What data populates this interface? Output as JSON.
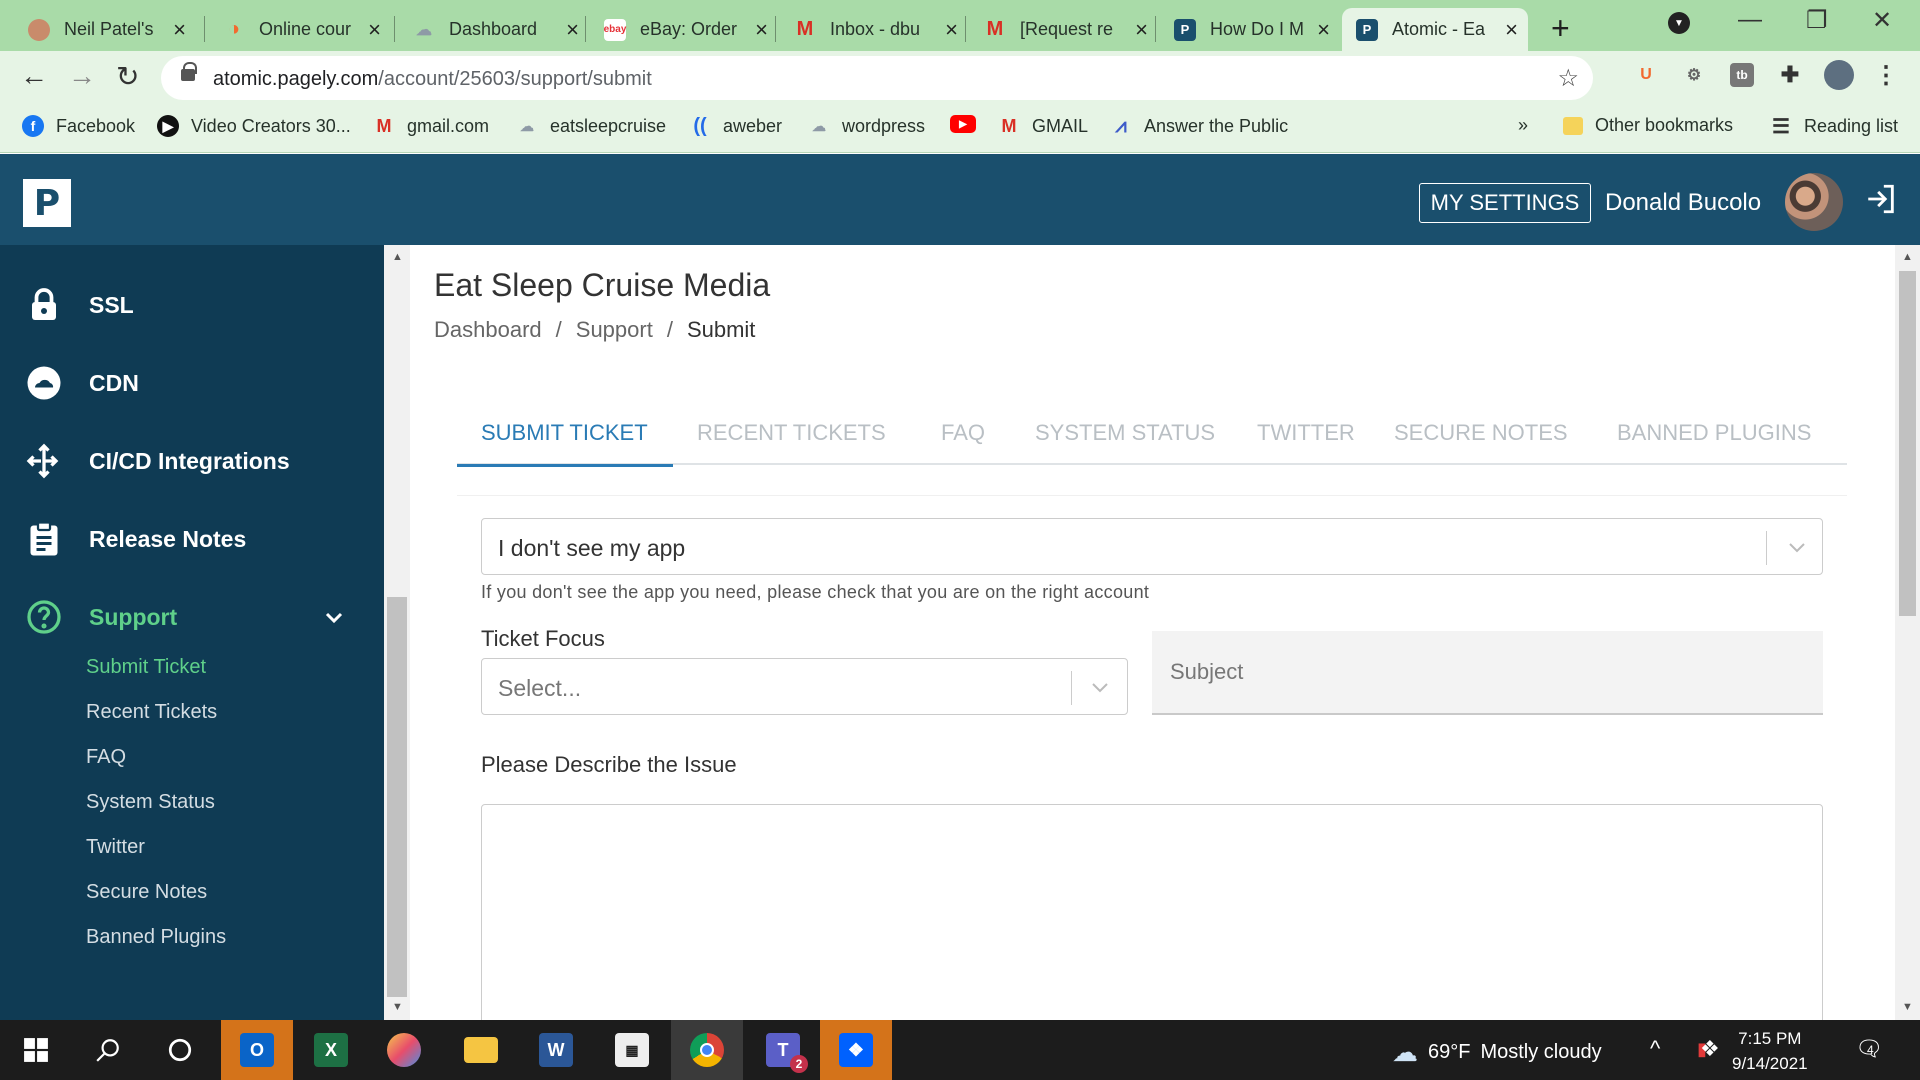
{
  "browser": {
    "tabs": [
      {
        "title": "Neil Patel's",
        "favicon_color": "#c98b6b"
      },
      {
        "title": "Online cour",
        "favicon_color": "#f26a2f"
      },
      {
        "title": "Dashboard",
        "favicon_color": "#8e9aa6"
      },
      {
        "title": "eBay: Order",
        "favicon_color": "#e53238"
      },
      {
        "title": "Inbox - dbu",
        "favicon_color": "#d93025"
      },
      {
        "title": "[Request re",
        "favicon_color": "#d93025"
      },
      {
        "title": "How Do I M",
        "favicon_color": "#1a4f6d"
      },
      {
        "title": "Atomic - Ea",
        "favicon_color": "#1a4f6d"
      }
    ],
    "active_tab": 7,
    "url_host": "atomic.pagely.com",
    "url_path": "/account/25603/support/submit",
    "bookmarks": [
      {
        "label": "Facebook",
        "icon": "facebook-icon",
        "color": "#1877f2"
      },
      {
        "label": "Video Creators 30...",
        "icon": "video-icon",
        "color": "#111111"
      },
      {
        "label": "gmail.com",
        "icon": "gmail-icon",
        "color": "#d93025"
      },
      {
        "label": "eatsleepcruise",
        "icon": "cloud-icon",
        "color": "#8e9aa6"
      },
      {
        "label": "aweber",
        "icon": "aweber-icon",
        "color": "#246be8"
      },
      {
        "label": "wordpress",
        "icon": "cloud-icon",
        "color": "#8e9aa6"
      },
      {
        "label": "GMAIL",
        "icon": "gmail-icon",
        "color": "#d93025"
      },
      {
        "label": "Answer the Public",
        "icon": "atp-icon",
        "color": "#3d5bc9"
      }
    ],
    "other_bookmarks": "Other bookmarks",
    "reading_list": "Reading list",
    "overflow": "»"
  },
  "header": {
    "logo_letter": "P",
    "my_settings": "MY SETTINGS",
    "user_name": "Donald Bucolo"
  },
  "sidebar": {
    "items": [
      {
        "label": "SSL",
        "icon": "lock-icon"
      },
      {
        "label": "CDN",
        "icon": "cloud-icon"
      },
      {
        "label": "CI/CD Integrations",
        "icon": "arrows-icon"
      },
      {
        "label": "Release Notes",
        "icon": "clipboard-icon"
      },
      {
        "label": "Support",
        "icon": "help-circle-icon"
      }
    ],
    "support_subitems": [
      "Submit Ticket",
      "Recent Tickets",
      "FAQ",
      "System Status",
      "Twitter",
      "Secure Notes",
      "Banned Plugins"
    ]
  },
  "main": {
    "org_title": "Eat Sleep Cruise Media",
    "breadcrumb": [
      "Dashboard",
      "/",
      "Support",
      "/",
      "Submit"
    ],
    "tabs": [
      "SUBMIT TICKET",
      "RECENT TICKETS",
      "FAQ",
      "SYSTEM STATUS",
      "TWITTER",
      "SECURE NOTES",
      "BANNED PLUGINS"
    ],
    "app_select_value": "I don't see my app",
    "app_help": "If you don't see the app you need, please check that you are on the right account",
    "ticket_focus_label": "Ticket Focus",
    "ticket_focus_placeholder": "Select...",
    "subject_placeholder": "Subject",
    "describe_label": "Please Describe the Issue"
  },
  "taskbar": {
    "weather_temp": "69°F",
    "weather_text": "Mostly cloudy",
    "time": "7:15 PM",
    "date": "9/14/2021",
    "teams_badge": "2",
    "notifications": "4"
  },
  "colors": {
    "header_bg": "#1a4f6d",
    "sidebar_bg": "#0f3b54",
    "accent_green": "#5fd08a",
    "tab_active": "#2a7bb5",
    "chrome_green": "#a9dba8"
  }
}
